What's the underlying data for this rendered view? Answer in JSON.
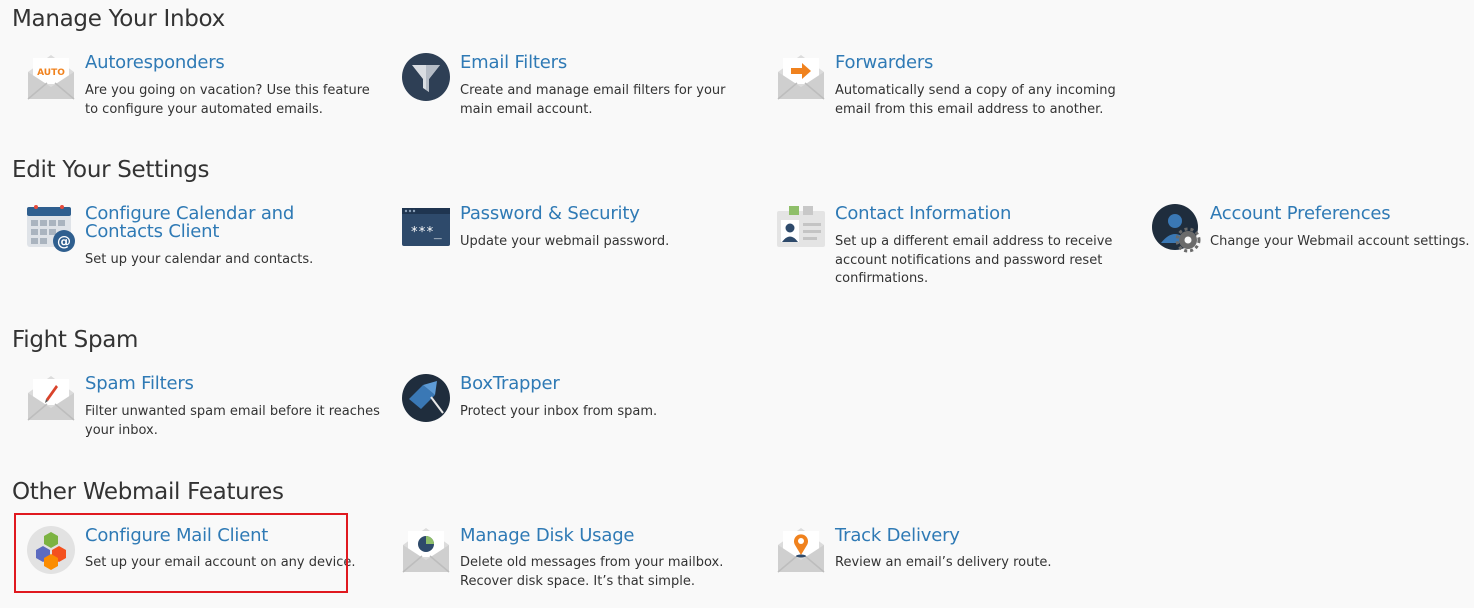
{
  "sections": [
    {
      "title": "Manage Your Inbox",
      "items": [
        {
          "title": "Autoresponders",
          "desc": "Are you going on vacation? Use this feature to configure your automated emails.",
          "icon": "autoresponder-icon",
          "icon_text": "AUTO"
        },
        {
          "title": "Email Filters",
          "desc": "Create and manage email filters for your main email account.",
          "icon": "filter-funnel-icon"
        },
        {
          "title": "Forwarders",
          "desc": "Automatically send a copy of any incoming email from this email address to another.",
          "icon": "forward-arrow-icon"
        }
      ]
    },
    {
      "title": "Edit Your Settings",
      "items": [
        {
          "title": "Configure Calendar and Contacts Client",
          "desc": "Set up your calendar and contacts.",
          "icon": "calendar-at-icon"
        },
        {
          "title": "Password & Security",
          "desc": "Update your webmail password.",
          "icon": "password-window-icon",
          "icon_text": "***_"
        },
        {
          "title": "Contact Information",
          "desc": "Set up a different email address to receive account notifications and password reset confirmations.",
          "icon": "contact-card-icon"
        },
        {
          "title": "Account Preferences",
          "desc": "Change your Webmail account settings.",
          "icon": "user-gear-icon"
        }
      ]
    },
    {
      "title": "Fight Spam",
      "items": [
        {
          "title": "Spam Filters",
          "desc": "Filter unwanted spam email before it reaches your inbox.",
          "icon": "spam-envelope-icon"
        },
        {
          "title": "BoxTrapper",
          "desc": "Protect your inbox from spam.",
          "icon": "box-trap-icon"
        }
      ]
    },
    {
      "title": "Other Webmail Features",
      "items": [
        {
          "title": "Configure Mail Client",
          "desc": "Set up your email account on any device.",
          "icon": "mail-client-cubes-icon"
        },
        {
          "title": "Manage Disk Usage",
          "desc": "Delete old messages from your mailbox. Recover disk space. It’s that simple.",
          "icon": "disk-usage-envelope-icon"
        },
        {
          "title": "Track Delivery",
          "desc": "Review an email’s delivery route.",
          "icon": "track-pin-envelope-icon"
        }
      ]
    }
  ],
  "colors": {
    "link": "#2f7ab5",
    "highlight": "#e0191f",
    "background": "#f9f9f9"
  }
}
